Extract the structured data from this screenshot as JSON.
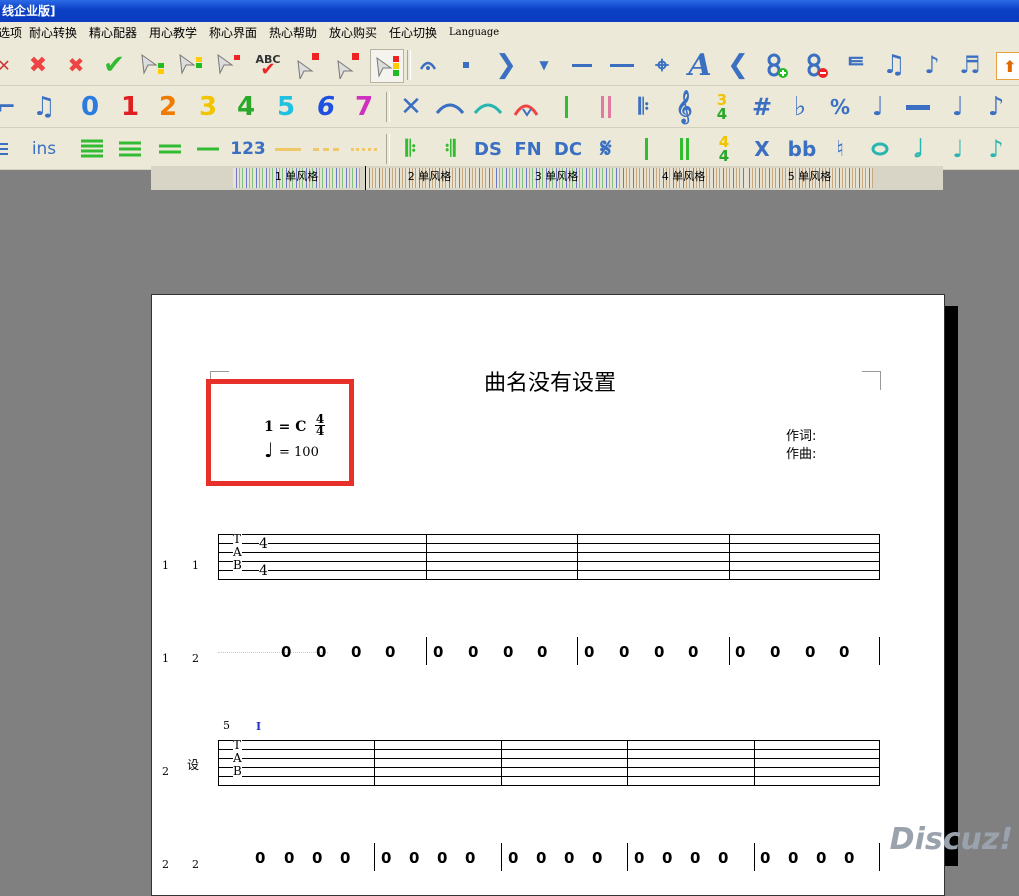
{
  "window": {
    "title": "线企业版]"
  },
  "menu": [
    {
      "label": "选项"
    },
    {
      "label": "耐心转换"
    },
    {
      "label": "精心配器"
    },
    {
      "label": "用心教学"
    },
    {
      "label": "称心界面"
    },
    {
      "label": "热心帮助"
    },
    {
      "label": "放心购买"
    },
    {
      "label": "任心切换"
    },
    {
      "label": "Language"
    }
  ],
  "toolbar_row1": {
    "text_abc": "ABC",
    "letter_a": "A",
    "icon_names": [
      "delete-red-x-icon",
      "remove-icon",
      "check-icon",
      "select-level-icon",
      "select-level-2-icon",
      "select-level-3-icon",
      "spellcheck-icon",
      "cursor-red-icon",
      "cursor-red-2-icon",
      "cursor-active-icon",
      "arc-dot-icon",
      "dot-icon",
      "arrow-right-icon",
      "arrow-down-icon",
      "dash-icon",
      "dash-2-icon",
      "crosshair-icon",
      "letter-a-icon",
      "chevron-left-icon",
      "add-note-icon",
      "remove-note-icon",
      "stroke-icon",
      "note-beam-icon",
      "note-flag-icon",
      "eighth-notes-icon",
      "export-icon"
    ]
  },
  "toolbar_row2": {
    "digits": [
      "0",
      "1",
      "2",
      "3",
      "4",
      "5",
      "6",
      "7"
    ],
    "digit_colors": [
      "#2b7be0",
      "#e02020",
      "#f07b00",
      "#f0c400",
      "#2aa82a",
      "#20c0e0",
      "#2050e0",
      "#d030c0"
    ],
    "time_sig": {
      "top": "3",
      "bottom": "4"
    },
    "sharp": "#",
    "flat": "♭",
    "percent": "%"
  },
  "toolbar_row3": {
    "ins": "ins",
    "n123": "123",
    "ds": "DS",
    "fn": "FN",
    "dc": "DC",
    "time_sig": {
      "top": "4",
      "bottom": "4"
    },
    "x": "X",
    "bb": "bb"
  },
  "tabs": [
    {
      "label": "1 单风格"
    },
    {
      "label": "2 单风格"
    },
    {
      "label": "3 单风格"
    },
    {
      "label": "4 单风格"
    },
    {
      "label": "5 单风格"
    }
  ],
  "score": {
    "title": "曲名没有设置",
    "key": "1 = C",
    "time_top": "4",
    "time_bottom": "4",
    "tempo_note": "♩",
    "tempo": "= 100",
    "lyricist": "作词:",
    "composer": "作曲:",
    "highlight_color": "#e8302a",
    "system1": {
      "tab_line": {
        "index": "1",
        "track": "1",
        "t": "T",
        "a": "A",
        "b": "B",
        "top_val": "4",
        "bottom_val": "4"
      },
      "numeric_line": {
        "index": "1",
        "track": "2",
        "measures": [
          [
            "0",
            "0",
            "0",
            "0"
          ],
          [
            "0",
            "0",
            "0",
            "0"
          ],
          [
            "0",
            "0",
            "0",
            "0"
          ],
          [
            "0",
            "0",
            "0",
            "0"
          ]
        ]
      }
    },
    "system2": {
      "measure_number": "5",
      "cursor": "I",
      "tab_line": {
        "index": "2",
        "track_label": "设",
        "t": "T",
        "a": "A",
        "b": "B"
      },
      "numeric_line": {
        "index": "2",
        "track": "2",
        "measures": [
          [
            "0",
            "0",
            "0",
            "0"
          ],
          [
            "0",
            "0",
            "0",
            "0"
          ],
          [
            "0",
            "0",
            "0",
            "0"
          ],
          [
            "0",
            "0",
            "0",
            "0"
          ],
          [
            "0",
            "0",
            "0",
            "0"
          ]
        ]
      }
    }
  },
  "watermark": "Discuz!"
}
